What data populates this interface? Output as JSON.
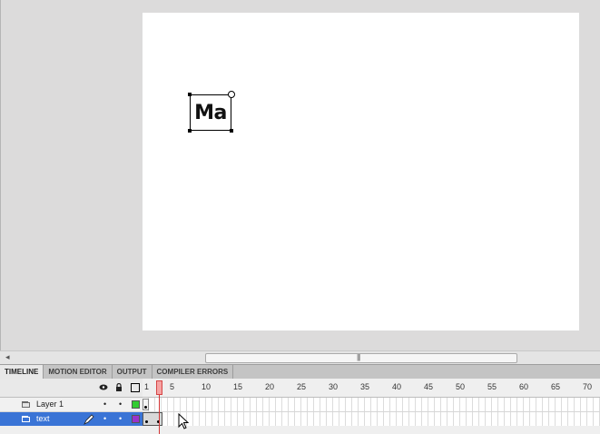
{
  "stage": {
    "text_content": "Ma"
  },
  "scrollbar": {
    "left_arrow": "◂",
    "grip": "|||"
  },
  "tabs": [
    {
      "label": "TIMELINE",
      "active": true
    },
    {
      "label": "MOTION EDITOR",
      "active": false
    },
    {
      "label": "OUTPUT",
      "active": false
    },
    {
      "label": "COMPILER ERRORS",
      "active": false
    }
  ],
  "timeline": {
    "frame_ticks": [
      "1",
      "5",
      "10",
      "15",
      "20",
      "25",
      "30",
      "35",
      "40",
      "45",
      "50",
      "55",
      "60",
      "65",
      "70"
    ],
    "current_frame": "1",
    "layers": [
      {
        "name": "Layer 1",
        "selected": false,
        "color": "#33cc33",
        "visible_dot": "•",
        "lock_dot": "•"
      },
      {
        "name": "text",
        "selected": true,
        "color": "#9933cc",
        "visible_dot": "•",
        "lock_dot": "•"
      }
    ]
  },
  "colors": {
    "selection_blue": "#3a74d6",
    "playhead_red": "#d23434"
  }
}
